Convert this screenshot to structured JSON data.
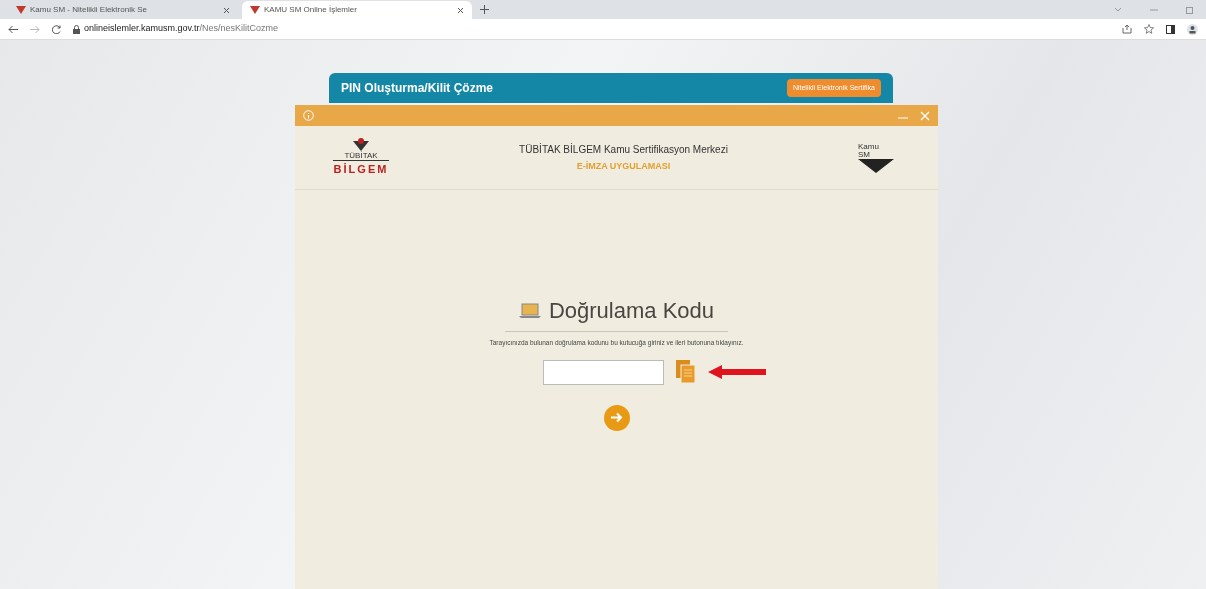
{
  "browser": {
    "tabs": [
      {
        "title": "Kamu SM - Nitelikli Elektronik Se",
        "selected": false
      },
      {
        "title": "KAMU SM Online İşlemler",
        "selected": true
      }
    ],
    "address": {
      "domain": "onlineislemler.kamusm.gov.tr",
      "path": "/Nes/nesKilitCozme"
    }
  },
  "page_panel": {
    "title": "PIN Oluşturma/Kilit Çözme",
    "button": "Nitelikli Elektronik Sertifika"
  },
  "app_window": {
    "header": {
      "left_logo": {
        "top": "TÜBİTAK",
        "bottom": "BİLGEM"
      },
      "title": "TÜBİTAK BİLGEM Kamu Sertifikasyon Merkezi",
      "subtitle": "E-İMZA UYGULAMASI",
      "right_logo": {
        "top": "Kamu",
        "bottom": "SM"
      }
    },
    "content": {
      "heading": "Doğrulama Kodu",
      "instruction": "Tarayıcınızda bulunan doğrulama kodunu bu kutucuğa giriniz ve ileri butonuna tıklayınız."
    }
  }
}
